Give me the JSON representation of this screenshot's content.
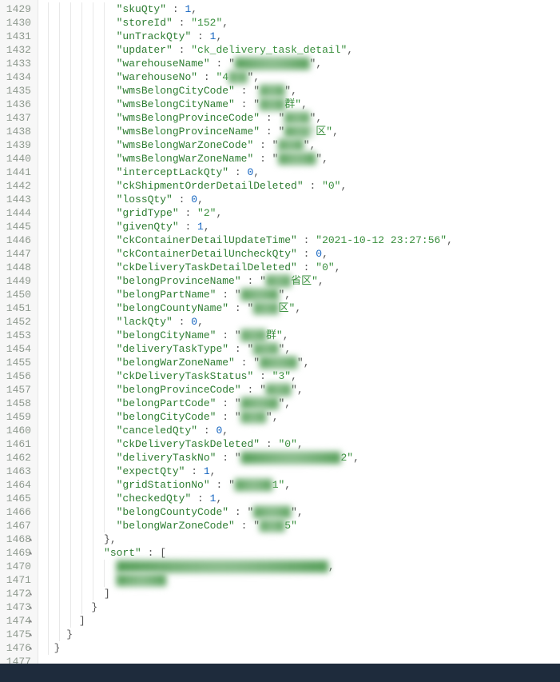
{
  "startLine": 1429,
  "endLine": 1477,
  "foldMarkers": [
    1468,
    1469,
    1472,
    1473,
    1474,
    1475,
    1476
  ],
  "lines": [
    {
      "indent": 6,
      "key": "skuQty",
      "value": 1,
      "type": "number"
    },
    {
      "indent": 6,
      "key": "storeId",
      "value": "152",
      "type": "string"
    },
    {
      "indent": 6,
      "key": "unTrackQty",
      "value": 1,
      "type": "number"
    },
    {
      "indent": 6,
      "key": "updater",
      "value": "ck_delivery_task_detail",
      "type": "string"
    },
    {
      "indent": 6,
      "key": "warehouseName",
      "value": "████████████",
      "type": "blur"
    },
    {
      "indent": 6,
      "key": "warehouseNo",
      "value": "4███",
      "type": "blur-partial",
      "prefix": "4"
    },
    {
      "indent": 6,
      "key": "wmsBelongCityCode",
      "value": "████",
      "type": "blur"
    },
    {
      "indent": 6,
      "key": "wmsBelongCityName",
      "value": "████群",
      "type": "blur-suffix",
      "suffix": "群"
    },
    {
      "indent": 6,
      "key": "wmsBelongProvinceCode",
      "value": "████",
      "type": "blur"
    },
    {
      "indent": 6,
      "key": "wmsBelongProvinceName",
      "value": "████^区",
      "type": "blur-suffix",
      "suffix": "区"
    },
    {
      "indent": 6,
      "key": "wmsBelongWarZoneCode",
      "value": "████",
      "type": "blur"
    },
    {
      "indent": 6,
      "key": "wmsBelongWarZoneName",
      "value": "██████",
      "type": "blur"
    },
    {
      "indent": 6,
      "key": "interceptLackQty",
      "value": 0,
      "type": "number"
    },
    {
      "indent": 6,
      "key": "ckShipmentOrderDetailDeleted",
      "value": "0",
      "type": "string"
    },
    {
      "indent": 6,
      "key": "lossQty",
      "value": 0,
      "type": "number"
    },
    {
      "indent": 6,
      "key": "gridType",
      "value": "2",
      "type": "string"
    },
    {
      "indent": 6,
      "key": "givenQty",
      "value": 1,
      "type": "number"
    },
    {
      "indent": 6,
      "key": "ckContainerDetailUpdateTime",
      "value": "2021-10-12 23:27:56",
      "type": "string"
    },
    {
      "indent": 6,
      "key": "ckContainerDetailUncheckQty",
      "value": 0,
      "type": "number"
    },
    {
      "indent": 6,
      "key": "ckDeliveryTaskDetailDeleted",
      "value": "0",
      "type": "string"
    },
    {
      "indent": 6,
      "key": "belongProvinceName",
      "value": "████省区",
      "type": "blur-suffix",
      "suffix": "省区"
    },
    {
      "indent": 6,
      "key": "belongPartName",
      "value": "██████",
      "type": "blur"
    },
    {
      "indent": 6,
      "key": "belongCountyName",
      "value": "████区",
      "type": "blur-suffix",
      "suffix": "区"
    },
    {
      "indent": 6,
      "key": "lackQty",
      "value": 0,
      "type": "number"
    },
    {
      "indent": 6,
      "key": "belongCityName",
      "value": "████群",
      "type": "blur-suffix",
      "suffix": "群"
    },
    {
      "indent": 6,
      "key": "deliveryTaskType",
      "value": "████",
      "type": "blur"
    },
    {
      "indent": 6,
      "key": "belongWarZoneName",
      "value": "██████",
      "type": "blur"
    },
    {
      "indent": 6,
      "key": "ckDeliveryTaskStatus",
      "value": "3",
      "type": "string"
    },
    {
      "indent": 6,
      "key": "belongProvinceCode",
      "value": "████",
      "type": "blur"
    },
    {
      "indent": 6,
      "key": "belongPartCode",
      "value": "██████",
      "type": "blur"
    },
    {
      "indent": 6,
      "key": "belongCityCode",
      "value": "████",
      "type": "blur"
    },
    {
      "indent": 6,
      "key": "canceledQty",
      "value": 0,
      "type": "number"
    },
    {
      "indent": 6,
      "key": "ckDeliveryTaskDeleted",
      "value": "0",
      "type": "string"
    },
    {
      "indent": 6,
      "key": "deliveryTaskNo",
      "value": "████████████████2",
      "type": "blur-suffix",
      "suffix": "2"
    },
    {
      "indent": 6,
      "key": "expectQty",
      "value": 1,
      "type": "number"
    },
    {
      "indent": 6,
      "key": "gridStationNo",
      "value": "██████1",
      "type": "blur-suffix",
      "suffix": "1"
    },
    {
      "indent": 6,
      "key": "checkedQty",
      "value": 1,
      "type": "number"
    },
    {
      "indent": 6,
      "key": "belongCountyCode",
      "value": "██████",
      "type": "blur"
    },
    {
      "indent": 6,
      "key": "belongWarZoneCode",
      "value": "████5",
      "type": "blur-suffix",
      "suffix": "5",
      "last": true
    }
  ],
  "closingLines": [
    {
      "indent": 5,
      "text": "},"
    },
    {
      "indent": 5,
      "key": "sort",
      "arrayOpen": true
    },
    {
      "indent": 6,
      "blur": true,
      "text": "██████████████████████████████████",
      "comma": true
    },
    {
      "indent": 6,
      "blur": true,
      "text": "████████"
    },
    {
      "indent": 5,
      "text": "]"
    },
    {
      "indent": 4,
      "text": "}"
    },
    {
      "indent": 3,
      "text": "]"
    },
    {
      "indent": 2,
      "text": "}"
    },
    {
      "indent": 1,
      "text": "}"
    },
    {
      "indent": 0,
      "text": ""
    }
  ]
}
